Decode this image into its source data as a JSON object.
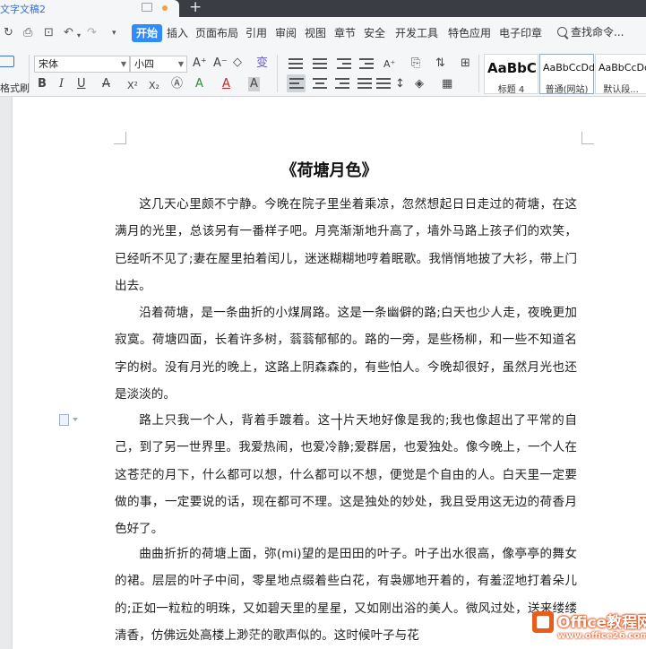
{
  "window": {
    "tab_title": "文字文稿2",
    "new_tab": "+"
  },
  "menu": {
    "items": [
      "开始",
      "插入",
      "页面布局",
      "引用",
      "审阅",
      "视图",
      "章节",
      "安全",
      "开发工具",
      "特色应用",
      "电子印章"
    ],
    "search": "查找命令..."
  },
  "ribbon": {
    "format_painter": "格式刷",
    "font_name": "宋体",
    "font_size": "小四",
    "styles": [
      {
        "sample": "AaBbC",
        "name": "标题 4"
      },
      {
        "sample": "AaBbCcDd",
        "name": "普通(网站)"
      },
      {
        "sample": "AaBbCcDd",
        "name": "默认段..."
      }
    ],
    "buttons": {
      "bold": "B",
      "italic": "I",
      "underline": "U",
      "strike": "A",
      "superscript": "X²",
      "subscript": "X₂",
      "grow_font": "A⁺",
      "shrink_font": "A⁻",
      "font_color": "A",
      "highlight": "A",
      "phonetic": "变"
    }
  },
  "document": {
    "title": "《荷塘月色》",
    "paragraphs": [
      "这几天心里颇不宁静。今晚在院子里坐着乘凉，忽然想起日日走过的荷塘，在这满月的光里，总该另有一番样子吧。月亮渐渐地升高了，墙外马路上孩子们的欢笑，已经听不见了;妻在屋里拍着闰儿，迷迷糊糊地哼着眠歌。我悄悄地披了大衫，带上门出去。",
      "沿着荷塘，是一条曲折的小煤屑路。这是一条幽僻的路;白天也少人走，夜晚更加寂寞。荷塘四面，长着许多树，蓊蓊郁郁的。路的一旁，是些杨柳，和一些不知道名字的树。没有月光的晚上，这路上阴森森的，有些怕人。今晚却很好，虽然月光也还是淡淡的。",
      "路上只我一个人，背着手踱着。这一片天地好像是我的;我也像超出了平常的自己，到了另一世界里。我爱热闹，也爱冷静;爱群居，也爱独处。像今晚上，一个人在这苍茫的月下，什么都可以想，什么都可以不想，便觉是个自由的人。白天里一定要做的事，一定要说的话，现在都可不理。这是独处的妙处，我且受用这无边的荷香月色好了。",
      "曲曲折折的荷塘上面，弥(mi)望的是田田的叶子。叶子出水很高，像亭亭的舞女的裙。层层的叶子中间，零星地点缀着些白花，有袅娜地开着的，有羞涩地打着朵儿的;正如一粒粒的明珠，又如碧天里的星星，又如刚出浴的美人。微风过处，送来缕缕清香，仿佛远处高楼上渺茫的歌声似的。这时候叶子与花"
    ]
  },
  "watermark": {
    "brand": "Office教程网",
    "url": "www.office26.com"
  }
}
